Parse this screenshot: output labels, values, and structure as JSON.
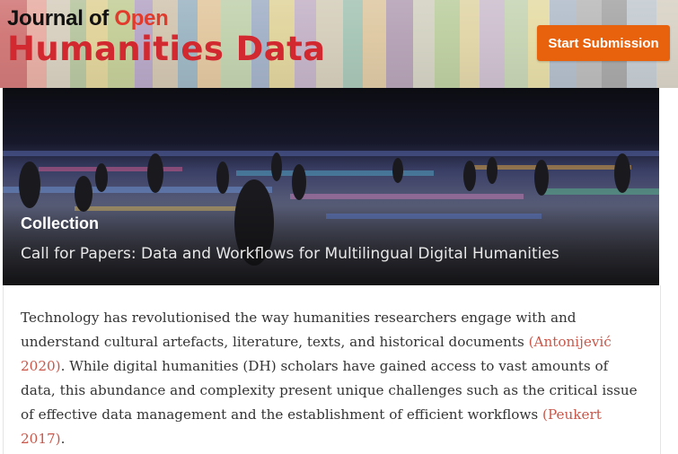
{
  "header": {
    "logo_line1_journal_of": "Journal of",
    "logo_line1_open": "Open",
    "logo_line2": "Humanities Data",
    "submit_label": "Start Submission"
  },
  "hero": {
    "label": "Collection",
    "title": "Call for Papers: Data and Workflows for Multilingual Digital Humanities"
  },
  "article": {
    "text_1": "Technology has revolutionised the way humanities researchers engage with and understand cultural artefacts, literature, texts, and historical documents ",
    "cite_1": "(Antonijević 2020)",
    "text_2": ". While digital humanities (DH) scholars have gained access to vast amounts of data, this abundance and complexity present unique challenges such as the critical issue of effective data management and the establishment of efficient workflows ",
    "cite_2": "(Peukert 2017)",
    "text_3": "."
  },
  "colors": {
    "brand_red": "#d2282f",
    "button_orange": "#e8620e",
    "citation": "#c8574a"
  }
}
